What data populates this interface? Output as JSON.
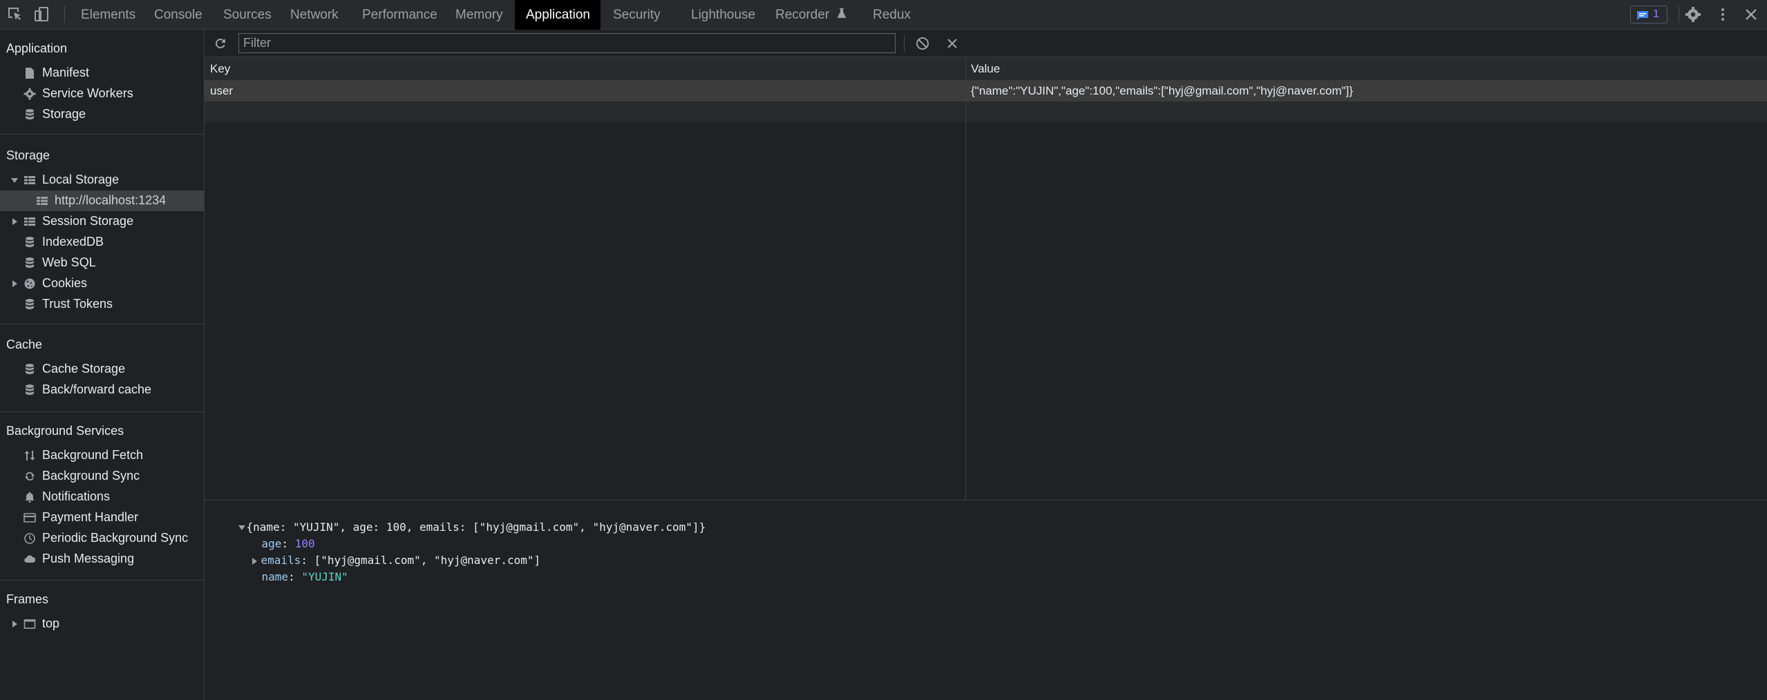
{
  "tabs": [
    {
      "label": "Elements",
      "active": false
    },
    {
      "label": "Console",
      "active": false
    },
    {
      "label": "Sources",
      "active": false
    },
    {
      "label": "Network",
      "active": false
    },
    {
      "label": "Performance",
      "active": false
    },
    {
      "label": "Memory",
      "active": false
    },
    {
      "label": "Application",
      "active": true
    },
    {
      "label": "Security",
      "active": false
    },
    {
      "label": "Lighthouse",
      "active": false
    },
    {
      "label": "Recorder",
      "active": false
    },
    {
      "label": "Redux",
      "active": false
    }
  ],
  "issues_badge": {
    "count": "1",
    "color": "#8ab4f8"
  },
  "sidebar": {
    "application": {
      "title": "Application",
      "items": [
        {
          "label": "Manifest",
          "icon": "file-icon"
        },
        {
          "label": "Service Workers",
          "icon": "gear-icon"
        },
        {
          "label": "Storage",
          "icon": "database-icon"
        }
      ]
    },
    "storage": {
      "title": "Storage",
      "items": [
        {
          "label": "Local Storage",
          "icon": "table-icon",
          "expanded": true
        },
        {
          "label": "http://localhost:1234",
          "icon": "table-icon",
          "selected": true
        },
        {
          "label": "Session Storage",
          "icon": "table-icon",
          "expanded": false
        },
        {
          "label": "IndexedDB",
          "icon": "database-icon"
        },
        {
          "label": "Web SQL",
          "icon": "database-icon"
        },
        {
          "label": "Cookies",
          "icon": "cookie-icon",
          "expanded": false
        },
        {
          "label": "Trust Tokens",
          "icon": "database-icon"
        }
      ]
    },
    "cache": {
      "title": "Cache",
      "items": [
        {
          "label": "Cache Storage",
          "icon": "database-icon"
        },
        {
          "label": "Back/forward cache",
          "icon": "database-icon"
        }
      ]
    },
    "background": {
      "title": "Background Services",
      "items": [
        {
          "label": "Background Fetch",
          "icon": "arrows-updown-icon"
        },
        {
          "label": "Background Sync",
          "icon": "sync-icon"
        },
        {
          "label": "Notifications",
          "icon": "bell-icon"
        },
        {
          "label": "Payment Handler",
          "icon": "card-icon"
        },
        {
          "label": "Periodic Background Sync",
          "icon": "clock-icon"
        },
        {
          "label": "Push Messaging",
          "icon": "cloud-icon"
        }
      ]
    },
    "frames": {
      "title": "Frames",
      "items": [
        {
          "label": "top",
          "icon": "frame-icon",
          "expanded": false
        }
      ]
    }
  },
  "toolbar": {
    "filter_placeholder": "Filter"
  },
  "table": {
    "columns": [
      "Key",
      "Value"
    ],
    "rows": [
      {
        "key": "user",
        "value": "{\"name\":\"YUJIN\",\"age\":100,\"emails\":[\"hyj@gmail.com\",\"hyj@naver.com\"]}"
      }
    ]
  },
  "preview": {
    "summary": "{name: \"YUJIN\", age: 100, emails: [\"hyj@gmail.com\", \"hyj@naver.com\"]}",
    "props": [
      {
        "key": "age",
        "value": "100",
        "kind": "number"
      },
      {
        "key": "emails",
        "value": "[\"hyj@gmail.com\", \"hyj@naver.com\"]",
        "kind": "array"
      },
      {
        "key": "name",
        "value": "\"YUJIN\"",
        "kind": "string"
      }
    ]
  }
}
